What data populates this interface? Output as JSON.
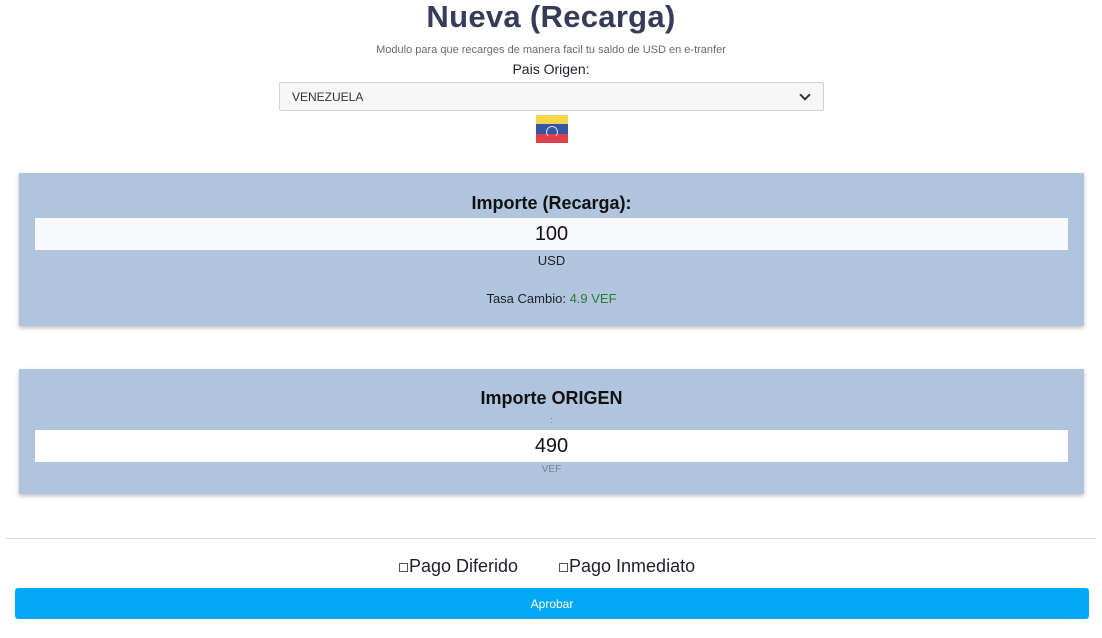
{
  "header": {
    "title": "Nueva (Recarga)",
    "subtitle": "Modulo para que recarges de manera facil tu saldo de USD en e-tranfer"
  },
  "origin": {
    "label": "Pais Origen:",
    "selected": "VENEZUELA",
    "flag_icon": "venezuela-flag-icon"
  },
  "recharge": {
    "title": "Importe (Recarga):",
    "amount": "100",
    "currency": "USD",
    "rate_label": "Tasa Cambio:",
    "rate_value": "4.9 VEF"
  },
  "origin_amount": {
    "title": "Importe ORIGEN",
    "separator": ":",
    "amount": "490",
    "currency": "VEF"
  },
  "payment": {
    "deferred_label": "Pago Diferido",
    "deferred_checked": false,
    "immediate_label": "Pago Inmediato",
    "immediate_checked": false
  },
  "actions": {
    "approve_label": "Aprobar"
  },
  "colors": {
    "card_bg": "#b0c4de",
    "button_bg": "#03a9f4",
    "rate_value": "#2c7a30",
    "title": "#363b57"
  }
}
